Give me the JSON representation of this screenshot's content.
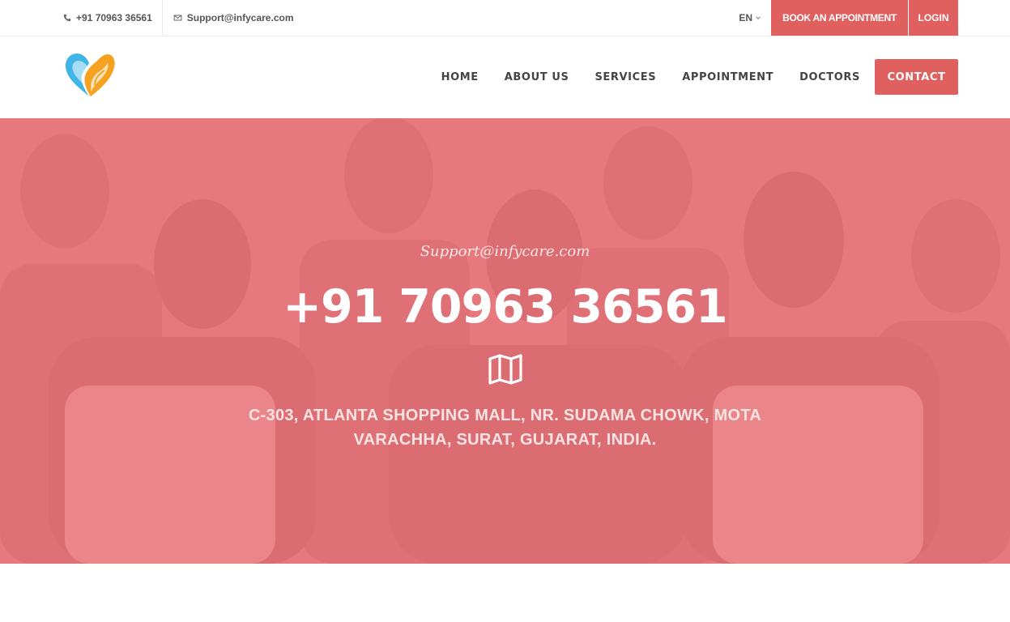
{
  "topbar": {
    "phone": "+91 70963 36561",
    "email": "Support@infycare.com",
    "language": "EN",
    "book_label": "BOOK AN APPOINTMENT",
    "login_label": "LOGIN"
  },
  "nav": {
    "items": [
      "HOME",
      "ABOUT US",
      "SERVICES",
      "APPOINTMENT",
      "DOCTORS"
    ],
    "contact_label": "CONTACT"
  },
  "hero": {
    "email": "Support@infycare.com",
    "phone": "+91 70963 36561",
    "address": "C-303, ATLANTA SHOPPING MALL, NR. SUDAMA CHOWK, MOTA VARACHHA, SURAT, GUJARAT, INDIA."
  },
  "icons": {
    "phone": "phone-icon",
    "mail": "mail-icon",
    "chevron": "chevron-down-icon",
    "map": "map-icon",
    "logo": "heart-logo"
  },
  "colors": {
    "accent": "#e06060",
    "overlay": "#e8686e",
    "logo_blue": "#3fb6e6",
    "logo_orange": "#f4a21f"
  }
}
